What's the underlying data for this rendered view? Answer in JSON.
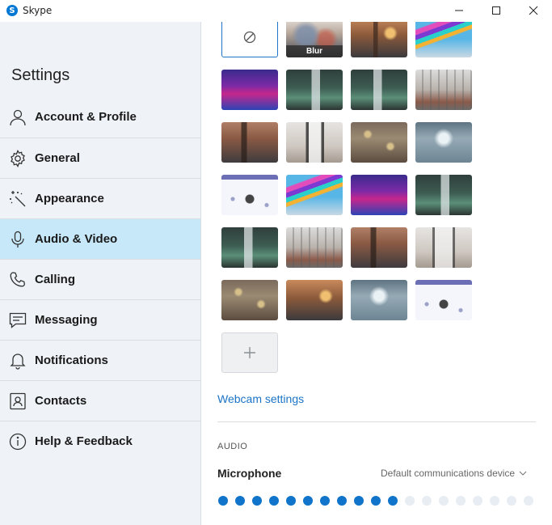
{
  "window": {
    "title": "Skype",
    "logo_letter": "S",
    "accent": "#0078d4"
  },
  "sidebar": {
    "title": "Settings",
    "active_index": 3,
    "active_color": "#c6e8f8",
    "items": [
      {
        "label": "Account & Profile",
        "icon": "person-icon"
      },
      {
        "label": "General",
        "icon": "gear-icon"
      },
      {
        "label": "Appearance",
        "icon": "magic-wand-icon"
      },
      {
        "label": "Audio & Video",
        "icon": "microphone-icon"
      },
      {
        "label": "Calling",
        "icon": "phone-icon"
      },
      {
        "label": "Messaging",
        "icon": "chat-icon"
      },
      {
        "label": "Notifications",
        "icon": "bell-icon"
      },
      {
        "label": "Contacts",
        "icon": "contact-card-icon"
      },
      {
        "label": "Help & Feedback",
        "icon": "info-icon"
      }
    ]
  },
  "backgrounds": {
    "blur_label": "Blur",
    "selected": "none",
    "none_icon": "no-effect-icon",
    "add_icon": "plus-icon"
  },
  "webcam": {
    "settings_link": "Webcam settings",
    "link_color": "#1b74c6"
  },
  "audio": {
    "section_label": "AUDIO",
    "microphone_label": "Microphone",
    "device": "Default communications device",
    "level_active": 11,
    "level_total": 19,
    "level_on_color": "#0f74ca",
    "level_off_color": "#e7edf3"
  }
}
